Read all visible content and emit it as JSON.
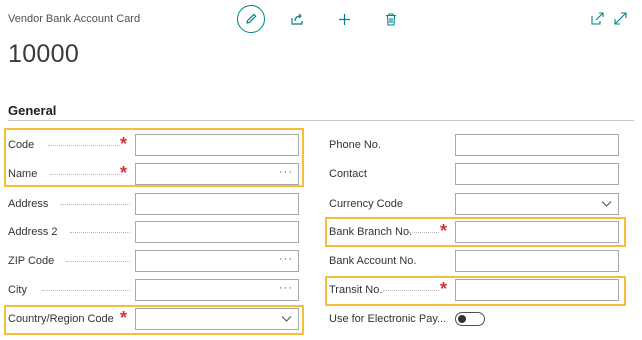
{
  "page": {
    "caption": "Vendor Bank Account Card",
    "record_no": "10000"
  },
  "actions": [
    "edit-icon",
    "share-icon",
    "plus-icon",
    "trash-icon",
    "popout-icon",
    "expand-icon"
  ],
  "section": {
    "title": "General"
  },
  "left_fields": [
    {
      "label": "Code",
      "value": "",
      "required": true
    },
    {
      "label": "Name",
      "value": "",
      "required": true,
      "lookup": "···"
    },
    {
      "label": "Address",
      "value": ""
    },
    {
      "label": "Address 2",
      "value": ""
    },
    {
      "label": "ZIP Code",
      "value": "",
      "lookup": "···"
    },
    {
      "label": "City",
      "value": "",
      "lookup": "···"
    },
    {
      "label": "Country/Region Code",
      "value": "",
      "required": true,
      "dropdown": true
    }
  ],
  "right_fields": [
    {
      "label": "Phone No.",
      "value": ""
    },
    {
      "label": "Contact",
      "value": ""
    },
    {
      "label": "Currency Code",
      "value": "",
      "dropdown": true
    },
    {
      "label": "Bank Branch No.",
      "value": "",
      "required": true
    },
    {
      "label": "Bank Account No.",
      "value": ""
    },
    {
      "label": "Transit No.",
      "value": "",
      "required": true
    },
    {
      "label": "Use for Electronic Pay...",
      "toggle": true,
      "value": "off"
    }
  ],
  "colors": {
    "accent": "#008489",
    "required": "#d13438",
    "highlight": "#f2c13c"
  }
}
